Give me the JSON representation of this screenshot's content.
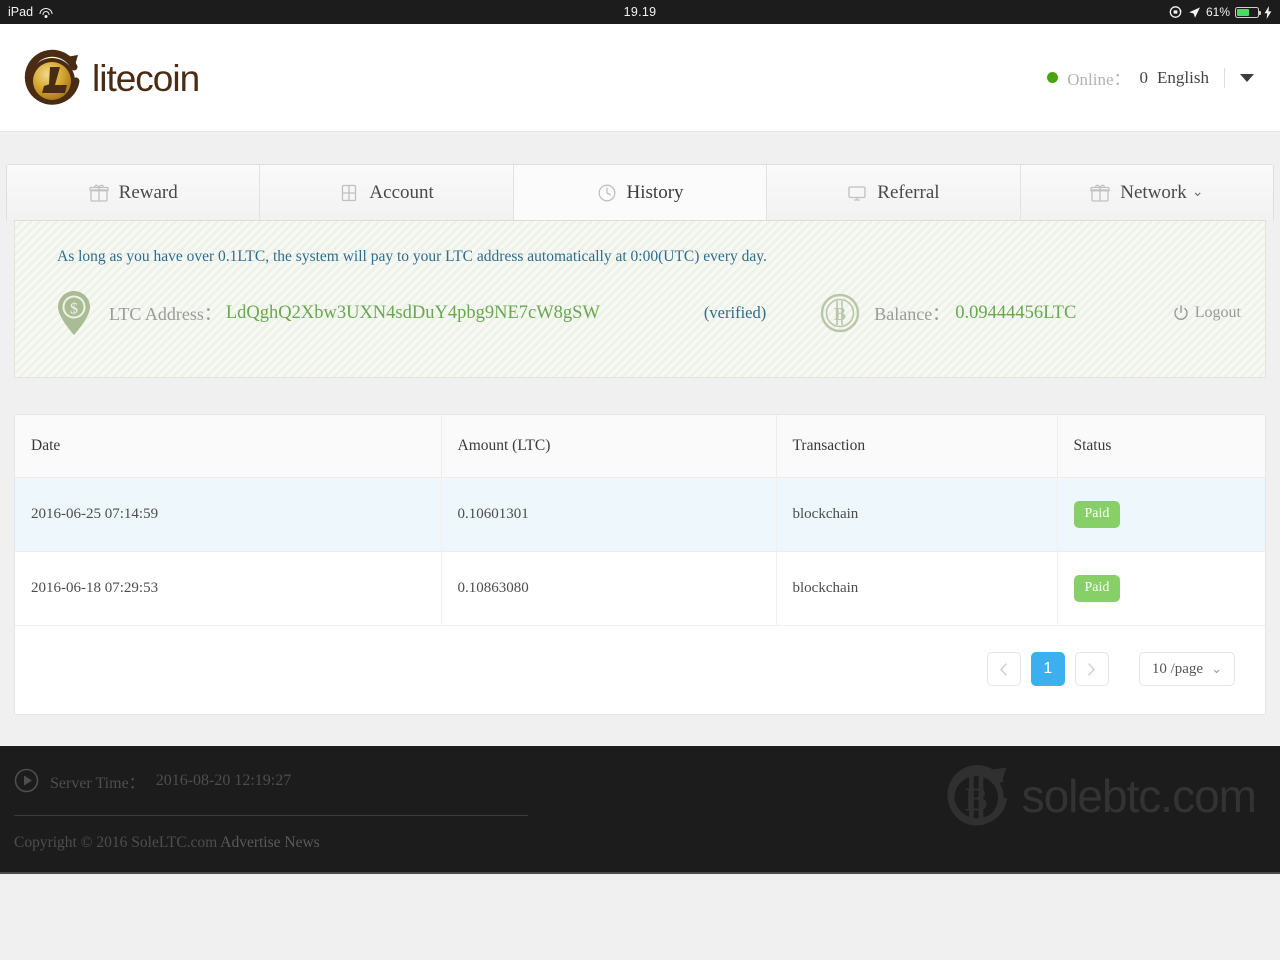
{
  "statusbar": {
    "device": "iPad",
    "wifi_icon": "wifi-icon",
    "time": "19.19",
    "rotation_lock_icon": "rotation-lock-icon",
    "location_icon": "location-arrow-icon",
    "battery_percent": "61%",
    "battery_level": 61,
    "charging_icon": "charging-bolt-icon"
  },
  "header": {
    "logo_text": "litecoin",
    "logo_icon": "litecoin-logo-icon",
    "online_dot_color": "#47a310",
    "online_label": "Online：",
    "online_count": "0",
    "language": "English",
    "caret_icon": "caret-down-icon"
  },
  "tabs": [
    {
      "label": "Reward",
      "icon": "gift-icon",
      "active": false,
      "has_chevron": false
    },
    {
      "label": "Account",
      "icon": "book-icon",
      "active": false,
      "has_chevron": false
    },
    {
      "label": "History",
      "icon": "clock-icon",
      "active": true,
      "has_chevron": false
    },
    {
      "label": "Referral",
      "icon": "monitor-icon",
      "active": false,
      "has_chevron": false
    },
    {
      "label": "Network",
      "icon": "gift-icon",
      "active": false,
      "has_chevron": true,
      "chevron": "⌄"
    }
  ],
  "panel": {
    "note": "As long as you have over 0.1LTC, the system will pay to your LTC address automatically at 0:00(UTC) every day.",
    "address_icon": "map-pin-dollar-icon",
    "address_label": "LTC Address：",
    "address_value": "LdQghQ2Xbw3UXN4sdDuY4pbg9NE7cW8gSW",
    "verified_text": "(verified)",
    "balance_icon": "bitcoin-circle-icon",
    "balance_label": "Balance：",
    "balance_value": "0.09444456LTC",
    "logout_label": "Logout",
    "logout_icon": "power-icon",
    "accent_green": "#6aa84f",
    "accent_blue": "#2d6e8e"
  },
  "table": {
    "columns": [
      "Date",
      "Amount (LTC)",
      "Transaction",
      "Status"
    ],
    "rows": [
      {
        "date": "2016-06-25 07:14:59",
        "amount": "0.10601301",
        "transaction": "blockchain",
        "status": "Paid",
        "highlighted": true
      },
      {
        "date": "2016-06-18 07:29:53",
        "amount": "0.10863080",
        "transaction": "blockchain",
        "status": "Paid",
        "highlighted": false
      }
    ],
    "badge_color": "#87d068"
  },
  "pagination": {
    "prev_icon": "chevron-left-icon",
    "next_icon": "chevron-right-icon",
    "pages": [
      "1"
    ],
    "current_page": "1",
    "page_size_label": "10 /page",
    "page_size_chevron": "⌄",
    "active_color": "#3cb0ee"
  },
  "footer": {
    "play_icon": "play-circle-icon",
    "server_time_label": "Server Time：",
    "server_time_value": "2016-08-20 12:19:27",
    "copyright": "Copyright © 2016 SoleLTC.com",
    "links": [
      "Advertise",
      "News"
    ],
    "watermark_text": "solebtc.com",
    "watermark_icon": "bitcoin-arrow-icon"
  }
}
